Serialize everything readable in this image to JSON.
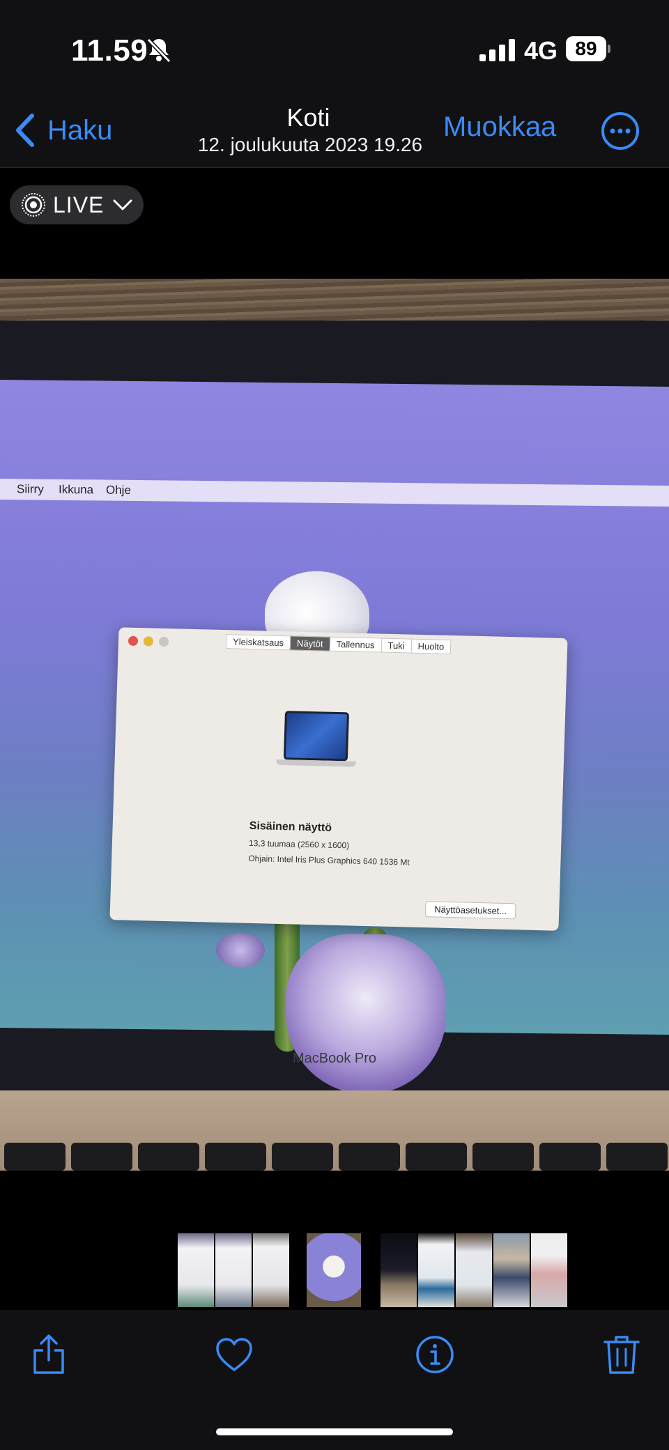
{
  "status_bar": {
    "time": "11.59",
    "network": "4G",
    "battery": "89",
    "icons": [
      "bell-slash-icon",
      "signal-bars-icon",
      "battery-icon"
    ]
  },
  "nav": {
    "back_label": "Haku",
    "title": "Koti",
    "subtitle": "12. joulukuuta 2023 19.26",
    "edit_label": "Muokkaa",
    "icons": [
      "chevron-left-icon",
      "more-icon"
    ]
  },
  "live_badge": {
    "label": "LIVE",
    "icons": [
      "live-photo-icon",
      "chevron-down-icon"
    ]
  },
  "photo": {
    "menubar_items": [
      "Siirry",
      "Ikkuna",
      "Ohje"
    ],
    "dialog": {
      "tabs": [
        "Yleiskatsaus",
        "Näytöt",
        "Tallennus",
        "Tuki",
        "Huolto"
      ],
      "active_tab": "Näytöt",
      "title": "Sisäinen näyttö",
      "line1": "13,3 tuumaa (2560 x 1600)",
      "line2": "Ohjain: Intel Iris Plus Graphics 640 1536 Mt",
      "button": "Näyttöasetukset..."
    },
    "brand": "MacBook Pro"
  },
  "toolbar": {
    "icons": [
      "share-icon",
      "heart-icon",
      "info-icon",
      "trash-icon"
    ]
  },
  "colors": {
    "accent": "#3a8bf5",
    "bar_bg": "#111113"
  }
}
